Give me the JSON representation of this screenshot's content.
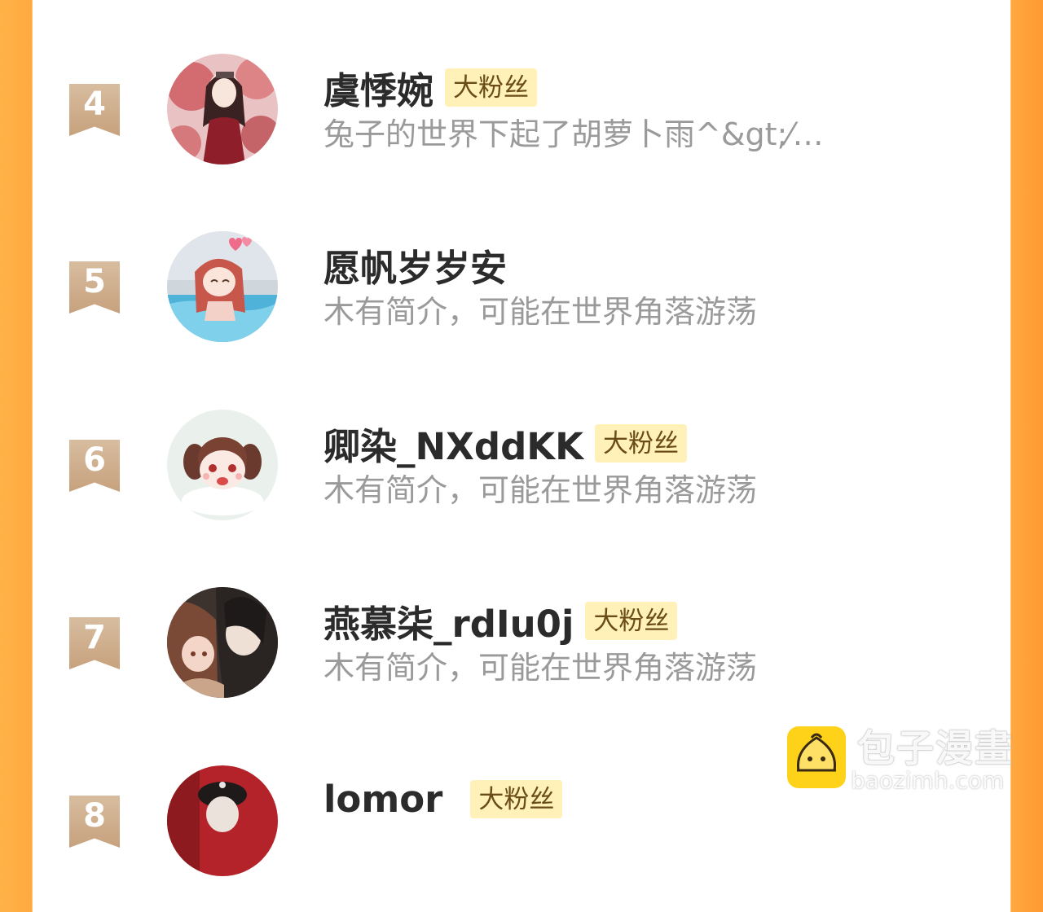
{
  "fans": [
    {
      "rank": "4",
      "name": "虞悸婉",
      "badge": "大粉丝",
      "bio": "兔子的世界下起了胡萝卜雨^&gt;⁄…"
    },
    {
      "rank": "5",
      "name": "愿帆岁岁安",
      "badge": "",
      "bio": "木有简介，可能在世界角落游荡"
    },
    {
      "rank": "6",
      "name": "卿染_NXddKK",
      "badge": "大粉丝",
      "bio": "木有简介，可能在世界角落游荡"
    },
    {
      "rank": "7",
      "name": "燕慕柒_rdIu0j",
      "badge": "大粉丝",
      "bio": "木有简介，可能在世界角落游荡"
    },
    {
      "rank": "8",
      "name": "lomor",
      "badge": "大粉丝",
      "bio": ""
    }
  ],
  "watermark": {
    "title": "包子漫畫",
    "url": "baozimh.com"
  },
  "colors": {
    "side_border": "#ffa940",
    "badge_bg": "#fff1b8",
    "rank_ribbon": "#c7a17d",
    "logo": "#ffd21a"
  }
}
